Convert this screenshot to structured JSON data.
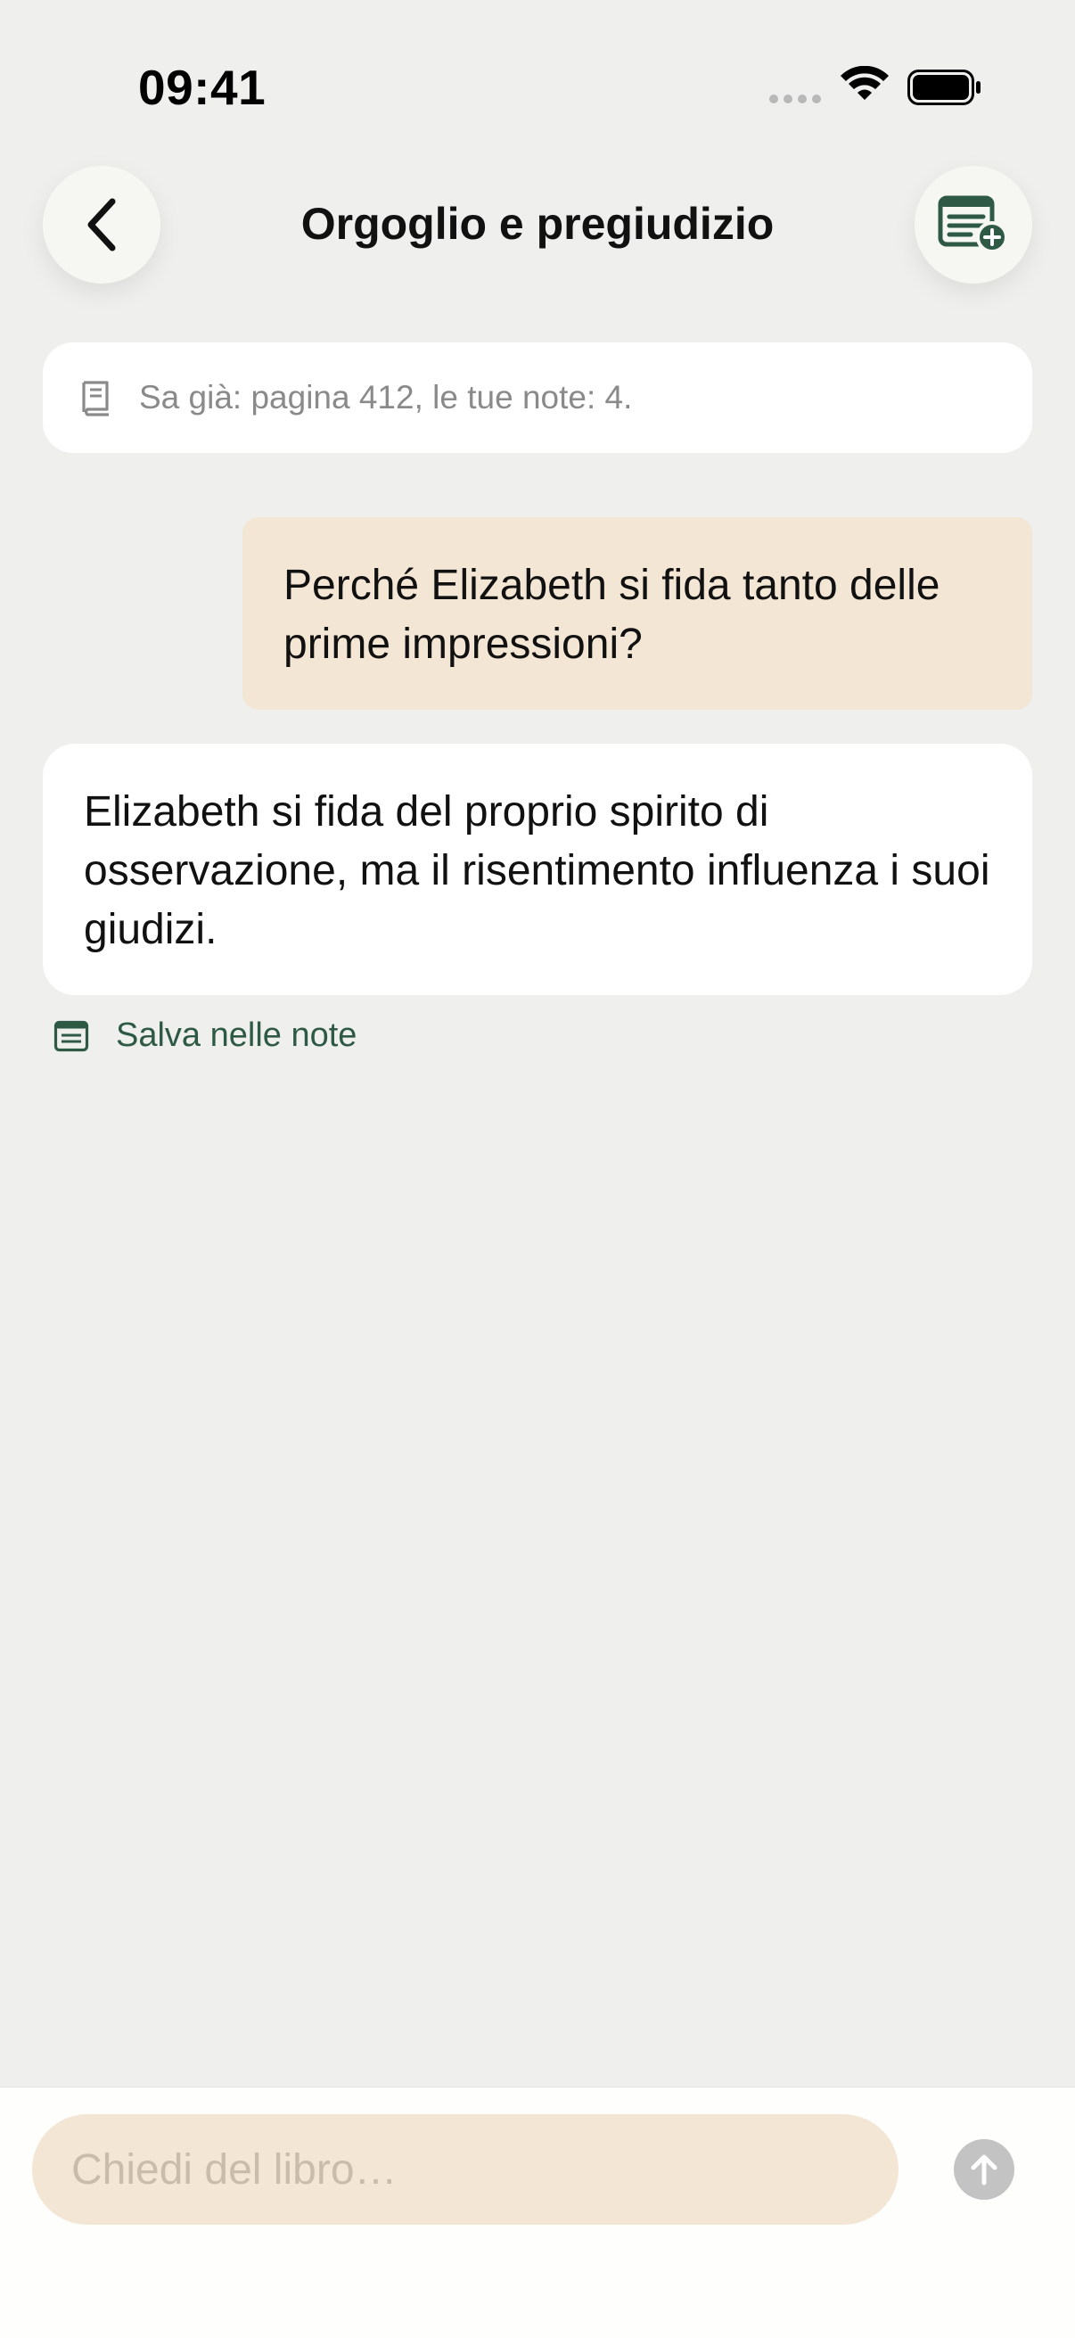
{
  "status_bar": {
    "time": "09:41"
  },
  "header": {
    "title": "Orgoglio e pregiudizio",
    "back_icon": "chevron-left-icon",
    "notes_icon": "notes-add-icon"
  },
  "info": {
    "text": "Sa già: pagina 412, le tue note: 4.",
    "icon": "book-icon"
  },
  "messages": {
    "user": "Perché Elizabeth si fida tanto delle prime impressioni?",
    "assistant": "Elizabeth si fida del proprio spirito di osservazione, ma il risentimento influenza i suoi giudizi."
  },
  "save_note": {
    "label": "Salva nelle note",
    "icon": "note-icon"
  },
  "composer": {
    "placeholder": "Chiedi del libro…",
    "value": "",
    "send_icon": "arrow-up-icon"
  },
  "colors": {
    "background": "#efefed",
    "accent_green": "#2e5a45",
    "user_bubble": "#f3e6d4",
    "input_bg": "#f3e6d4",
    "send_disabled": "#c3c3c3"
  }
}
